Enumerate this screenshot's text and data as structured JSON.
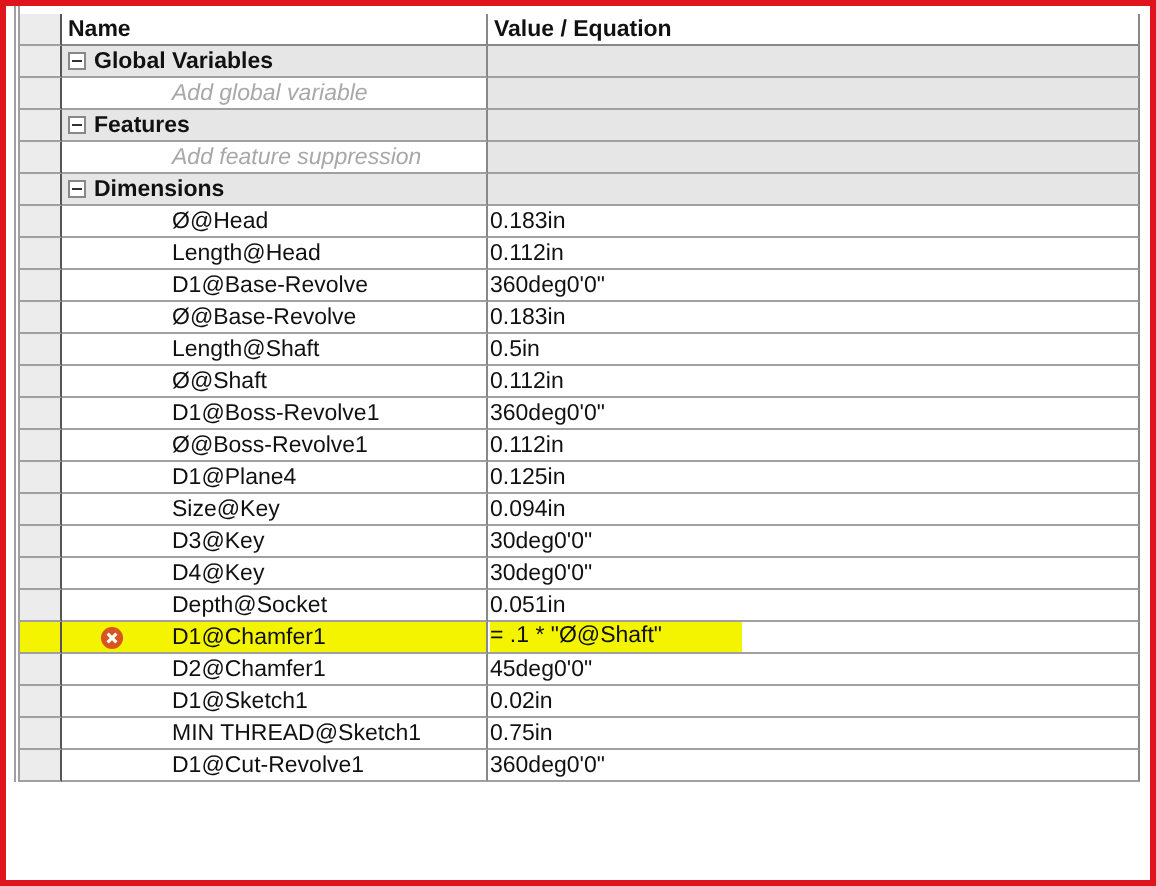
{
  "columns": [
    "Name",
    "Value / Equation"
  ],
  "sections": [
    {
      "title": "Global Variables",
      "expanded": true,
      "placeholder": "Add global variable"
    },
    {
      "title": "Features",
      "expanded": true,
      "placeholder": "Add feature suppression"
    },
    {
      "title": "Dimensions",
      "expanded": true,
      "rows": [
        {
          "name": "Ø@Head",
          "value": "0.183in",
          "error": false,
          "highlighted": false
        },
        {
          "name": "Length@Head",
          "value": "0.112in",
          "error": false,
          "highlighted": false
        },
        {
          "name": "D1@Base-Revolve",
          "value": "360deg0'0\"",
          "error": false,
          "highlighted": false
        },
        {
          "name": "Ø@Base-Revolve",
          "value": "0.183in",
          "error": false,
          "highlighted": false
        },
        {
          "name": "Length@Shaft",
          "value": "0.5in",
          "error": false,
          "highlighted": false
        },
        {
          "name": "Ø@Shaft",
          "value": "0.112in",
          "error": false,
          "highlighted": false
        },
        {
          "name": "D1@Boss-Revolve1",
          "value": "360deg0'0\"",
          "error": false,
          "highlighted": false
        },
        {
          "name": "Ø@Boss-Revolve1",
          "value": "0.112in",
          "error": false,
          "highlighted": false
        },
        {
          "name": "D1@Plane4",
          "value": "0.125in",
          "error": false,
          "highlighted": false
        },
        {
          "name": "Size@Key",
          "value": "0.094in",
          "error": false,
          "highlighted": false
        },
        {
          "name": "D3@Key",
          "value": "30deg0'0\"",
          "error": false,
          "highlighted": false
        },
        {
          "name": "D4@Key",
          "value": "30deg0'0\"",
          "error": false,
          "highlighted": false
        },
        {
          "name": "Depth@Socket",
          "value": "0.051in",
          "error": false,
          "highlighted": false
        },
        {
          "name": "D1@Chamfer1",
          "value": "= .1 * \"Ø@Shaft\"",
          "error": true,
          "highlighted": true
        },
        {
          "name": "D2@Chamfer1",
          "value": "45deg0'0\"",
          "error": false,
          "highlighted": false
        },
        {
          "name": "D1@Sketch1",
          "value": "0.02in",
          "error": false,
          "highlighted": false
        },
        {
          "name": "MIN THREAD@Sketch1",
          "value": "0.75in",
          "error": false,
          "highlighted": false
        },
        {
          "name": "D1@Cut-Revolve1",
          "value": "360deg0'0\"",
          "error": false,
          "highlighted": false
        }
      ]
    }
  ]
}
